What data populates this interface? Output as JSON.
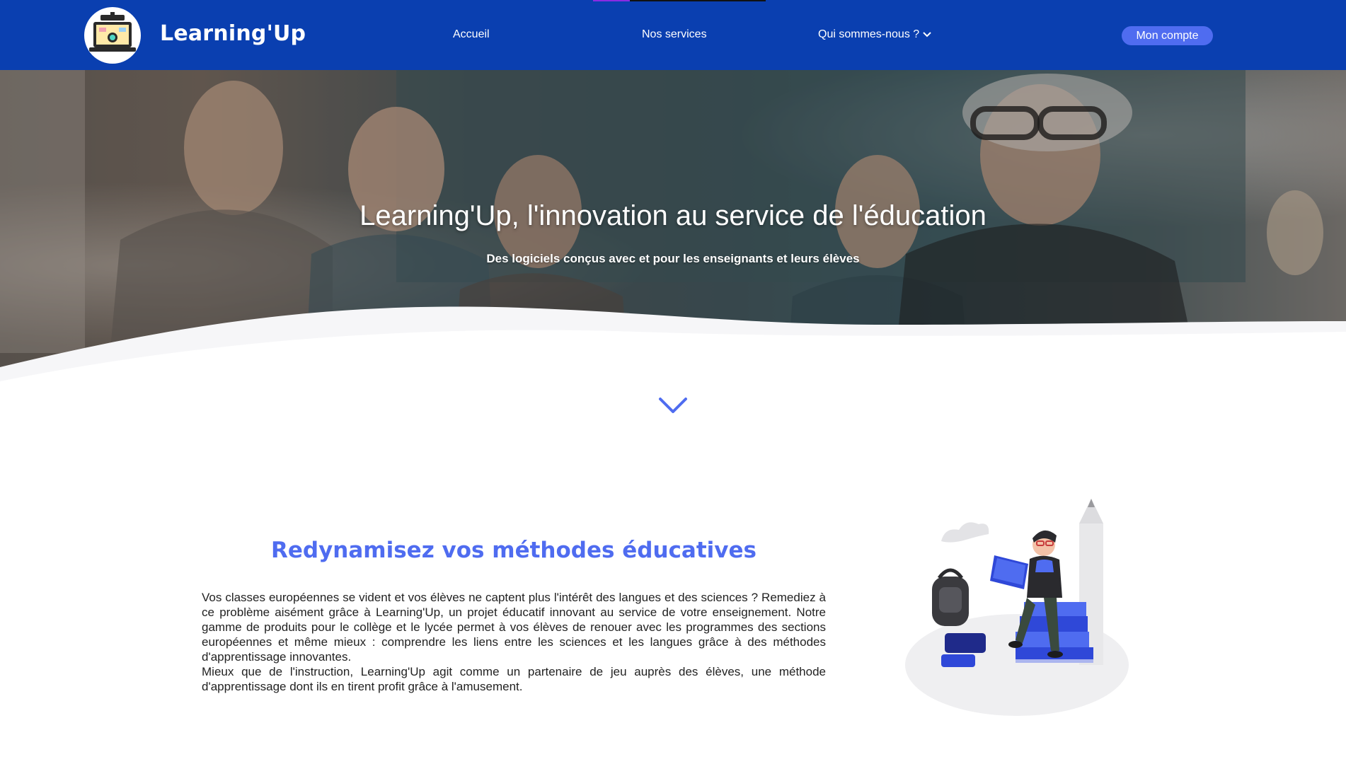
{
  "header": {
    "brand": "Learning'Up",
    "nav": {
      "home": "Accueil",
      "services": "Nos services",
      "about": "Qui sommes-nous ?"
    },
    "account_button": "Mon compte"
  },
  "hero": {
    "title": "Learning'Up, l'innovation au service de l'éducation",
    "subtitle": "Des logiciels conçus avec et pour les enseignants et leurs élèves"
  },
  "section": {
    "title": "Redynamisez vos méthodes éducatives",
    "paragraph1": "Vos classes européennes se vident et vos élèves ne captent plus l'intérêt des langues et des sciences ? Remediez à ce problème aisément grâce à Learning'Up, un projet éducatif innovant au service de votre enseignement. Notre gamme de produits pour le collège et le lycée permet à vos élèves de renouer avec les programmes des sections européennes et même mieux : comprendre les liens entre les sciences et les langues grâce à des méthodes d'apprentissage innovantes.",
    "paragraph2": "Mieux que de l'instruction, Learning'Up agit comme un partenaire de jeu auprès des élèves, une méthode d'apprentissage dont ils en tirent profit grâce à l'amusement."
  },
  "colors": {
    "navbar": "#0a3fb0",
    "accent": "#4f6cf0",
    "text": "#222222"
  },
  "icons": [
    "logo-laptop-icon",
    "chevron-down-icon",
    "scroll-down-chevron-icon"
  ]
}
